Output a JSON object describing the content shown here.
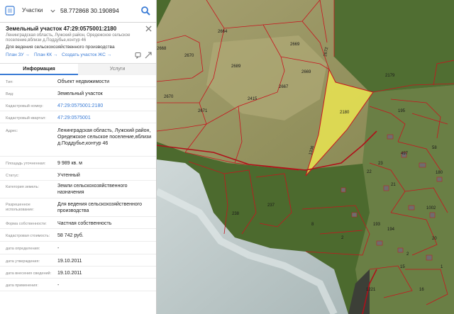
{
  "search": {
    "layer": "Участки",
    "coordinates": "58.772868 30.190894"
  },
  "parcel": {
    "title": "Земельный участок 47:29:0575001:2180",
    "address": "Ленинградская область, Лужский район, Оредежское сельское поселение,вблизи д.Поддубье,контур 46",
    "purpose": "Для ведения сельскохозяйственного производства",
    "links": {
      "plan_zu": "План ЗУ →",
      "plan_kk": "План КК →",
      "create_zhs": "Создать участок ЖС →"
    }
  },
  "tabs": {
    "info": "Информация",
    "services": "Услуги"
  },
  "rows": [
    {
      "label": "Тип:",
      "value": "Объект недвижимости"
    },
    {
      "label": "Вид:",
      "value": "Земельный участок"
    },
    {
      "label": "Кадастровый номер:",
      "value": "47:29:0575001:2180"
    },
    {
      "label": "Кадастровый квартал:",
      "value": "47:29:0575001"
    },
    {
      "label": "Адрес:",
      "value": "Ленинградская область, Лужский район, Оредежское сельское поселение,вблизи д.Поддубье,контур 46"
    },
    {
      "label": "Площадь уточненная:",
      "value": "9 989 кв. м"
    },
    {
      "label": "Статус:",
      "value": "Учтенный"
    },
    {
      "label": "Категория земель:",
      "value": "Земли сельскохозяйственного назначения"
    },
    {
      "label": "Разрешенное использование:",
      "value": "Для ведения сельскохозяйственного производства"
    },
    {
      "label": "Форма собственности:",
      "value": "Частная собственность"
    },
    {
      "label": "Кадастровая стоимость:",
      "value": "58 742 руб."
    },
    {
      "label": "дата определения:",
      "value": "-"
    },
    {
      "label": "дата утверждения:",
      "value": "19.10.2011"
    },
    {
      "label": "дата внесения сведений:",
      "value": "19.10.2011"
    },
    {
      "label": "дата применения:",
      "value": "-"
    }
  ],
  "map_labels": {
    "l2664": "2664",
    "l2668": "2668",
    "l2670": "2670",
    "l2669": "2669",
    "l2689": "2689",
    "l2667": "2667",
    "l2415": "2415",
    "l2671": "2671",
    "l2179": "2179",
    "l2180": "2180",
    "l1336": "1336",
    "l2180b": "2180",
    "l195": "195",
    "l497": "497",
    "l58": "58",
    "l23": "23",
    "l22": "22",
    "l238": "238",
    "l237": "237",
    "l1002": "1002",
    "l193": "193",
    "l194": "194",
    "l180": "180",
    "l2": "2",
    "l21": "21",
    "l8": "8",
    "l15": "15",
    "l1221": "1221",
    "l1": "1",
    "l16": "16",
    "l2x": "2",
    "l2672": "2672",
    "l20": "20"
  },
  "colors": {
    "accent": "#3a7bd5",
    "highlight_fill": "#f5f050",
    "parcel_border": "#c8141e"
  }
}
